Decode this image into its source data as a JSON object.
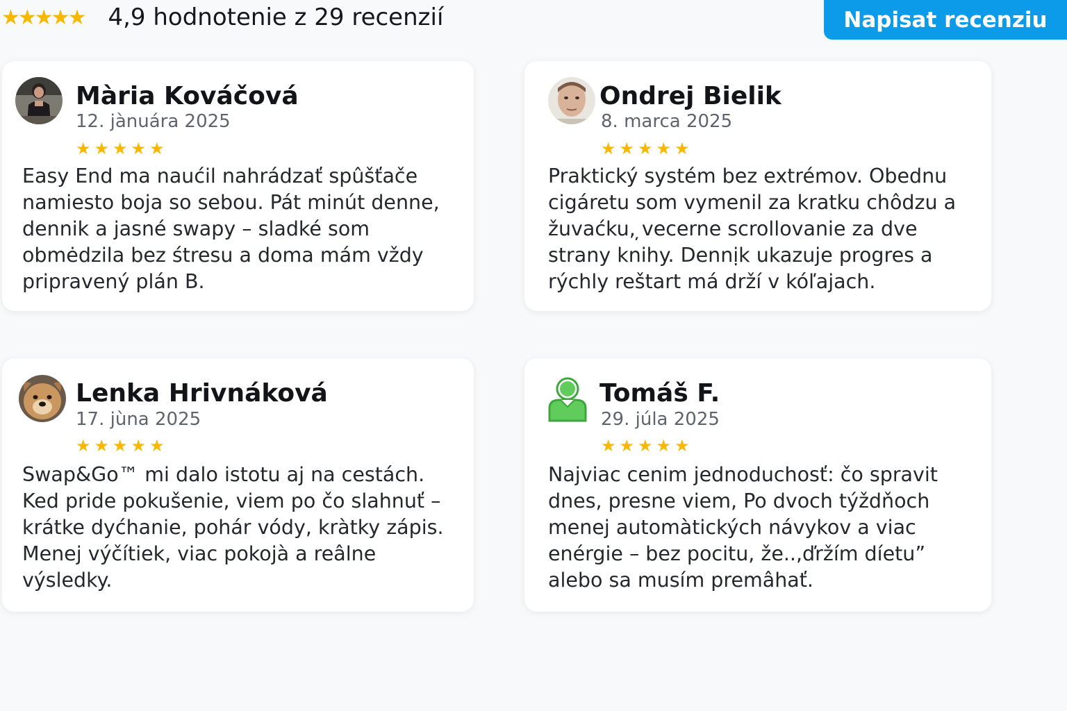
{
  "summary": {
    "stars": "★★★★★",
    "text": "4,9 hodnotenie z 29 recenzií"
  },
  "write_review_button": {
    "label": "Napisat recenziu"
  },
  "colors": {
    "accent": "#0b9be8",
    "star": "#f6b800",
    "avatar_icon_green": "#4cc24a"
  },
  "reviews": [
    {
      "name": "Mària Kováčová",
      "date": "12. jànuára 2025",
      "stars": "★★★★★",
      "text": "Easy End ma naućil nahrádzať spûšťače namiesto boja so sebou. Pát minút denne, dennik a jasné swapy – sladké som obmėdzila bez śtresu a doma mám vždy pripravený plán B.",
      "avatar": "woman-photo"
    },
    {
      "name": "Ondrej Bielik",
      "date": "8. marca 2025",
      "stars": "★★★★★",
      "text": "Praktický systém bez extrémov. Obednu cigáretu som vymenil za kratku chôdzu a žuvaćku, ̦vecerne scrollovanie za dve strany knihy. Dennịk ukazuje progres a rýchly reštart má drží v kóľajach.",
      "avatar": "man-photo"
    },
    {
      "name": "Lenka Hrivnáková",
      "date": "17. jùna 2025",
      "stars": "★★★★★",
      "text": "Swap&Go™ mi dalo istotu aj na cestách. Ked pride pokušenie, viem po čo slahnuť – krátke dyćhanie, pohár vódy, kràtky zápis. Menej výčítiek, viac pokojà a reâlne výsledky.",
      "avatar": "dog-photo"
    },
    {
      "name": "Tomáš F.",
      "date": "29. júla 2025",
      "stars": "★★★★★",
      "text": "Najviac cenim jednoduchosť: čo spravit dnes, presne viem, Po dvoch týždňoch menej automàtických návykov a viac enérgie – bez pocitu, že..,ďržím díetu” alebo sa musím premâhať.",
      "avatar": "user-icon"
    }
  ]
}
